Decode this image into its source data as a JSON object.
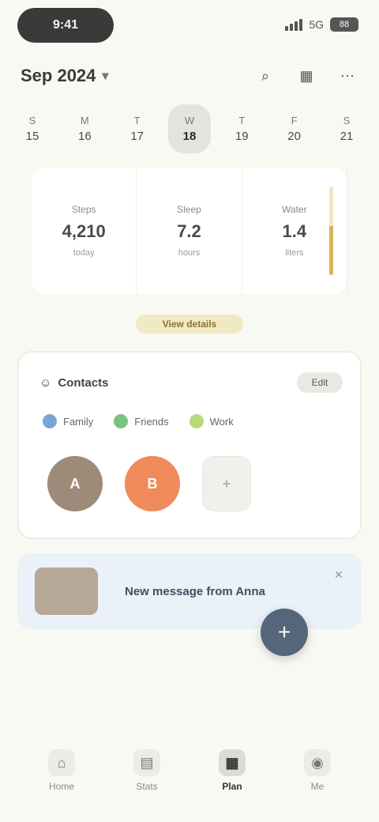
{
  "status_bar": {
    "time": "9:41",
    "network": "5G",
    "battery": "88"
  },
  "header": {
    "title": "Sep 2024",
    "chevron": "chevron-down-icon",
    "actions": [
      "search-icon",
      "calendar-icon",
      "more-icon"
    ]
  },
  "week": [
    {
      "day": "S",
      "date": "15"
    },
    {
      "day": "M",
      "date": "16"
    },
    {
      "day": "T",
      "date": "17"
    },
    {
      "day": "W",
      "date": "18",
      "active": true
    },
    {
      "day": "T",
      "date": "19"
    },
    {
      "day": "F",
      "date": "20"
    },
    {
      "day": "S",
      "date": "21"
    }
  ],
  "stats": [
    {
      "label": "Steps",
      "value": "4,210",
      "unit": "today"
    },
    {
      "label": "Sleep",
      "value": "7.2",
      "unit": "hours"
    },
    {
      "label": "Water",
      "value": "1.4",
      "unit": "liters"
    }
  ],
  "gold_progress": 0.55,
  "gold_link": "View details",
  "contacts": {
    "title": "Contacts",
    "manage": "Edit",
    "chips": [
      {
        "label": "Family",
        "color": "#7aa6d6"
      },
      {
        "label": "Friends",
        "color": "#7cc27a"
      },
      {
        "label": "Work",
        "color": "#b9d87a"
      }
    ],
    "avatars": [
      {
        "initial": "A",
        "color": "#9e8a78"
      },
      {
        "initial": "B",
        "color": "#ef8a5a"
      }
    ],
    "add_label": "+"
  },
  "banner": {
    "text": "New message from Anna",
    "close": "close-icon"
  },
  "fab_label": "+",
  "nav": [
    {
      "label": "Home",
      "icon": "home-icon"
    },
    {
      "label": "Stats",
      "icon": "chart-icon"
    },
    {
      "label": "Plan",
      "icon": "calendar-icon",
      "active": true
    },
    {
      "label": "Me",
      "icon": "user-icon"
    }
  ]
}
